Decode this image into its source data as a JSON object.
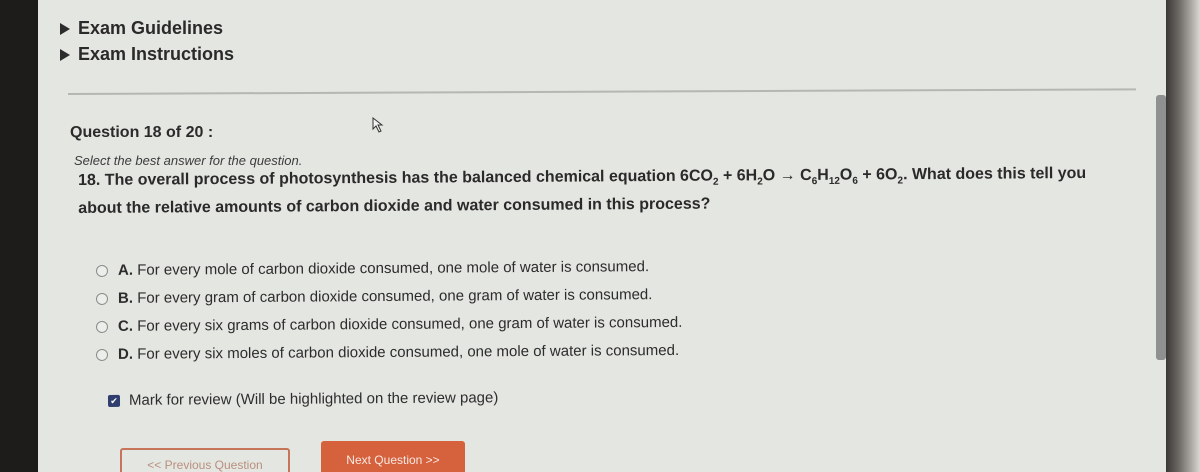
{
  "nav": {
    "guidelines_label": "Exam Guidelines",
    "instructions_label": "Exam Instructions"
  },
  "question": {
    "counter": "Question 18 of 20 :",
    "instruction": "Select the best answer for the question.",
    "number": "18.",
    "text_before": "The overall process of photosynthesis has the balanced chemical equation 6CO",
    "text_after": ". What does this tell you about the relative amounts of carbon dioxide and water consumed in this process?"
  },
  "options": [
    {
      "letter": "A.",
      "text": "For every mole of carbon dioxide consumed, one mole of water is consumed."
    },
    {
      "letter": "B.",
      "text": "For every gram of carbon dioxide consumed, one gram of water is consumed."
    },
    {
      "letter": "C.",
      "text": "For every six grams of carbon dioxide consumed, one gram of water is consumed."
    },
    {
      "letter": "D.",
      "text": "For every six moles of carbon dioxide consumed, one mole of water is consumed."
    }
  ],
  "review": {
    "label": "Mark for review (Will be highlighted on the review page)",
    "checked": true
  },
  "buttons": {
    "previous": "<< Previous Question",
    "next": "Next Question >>"
  },
  "colors": {
    "accent": "#d6613d",
    "checkbox": "#2f3e6e"
  }
}
